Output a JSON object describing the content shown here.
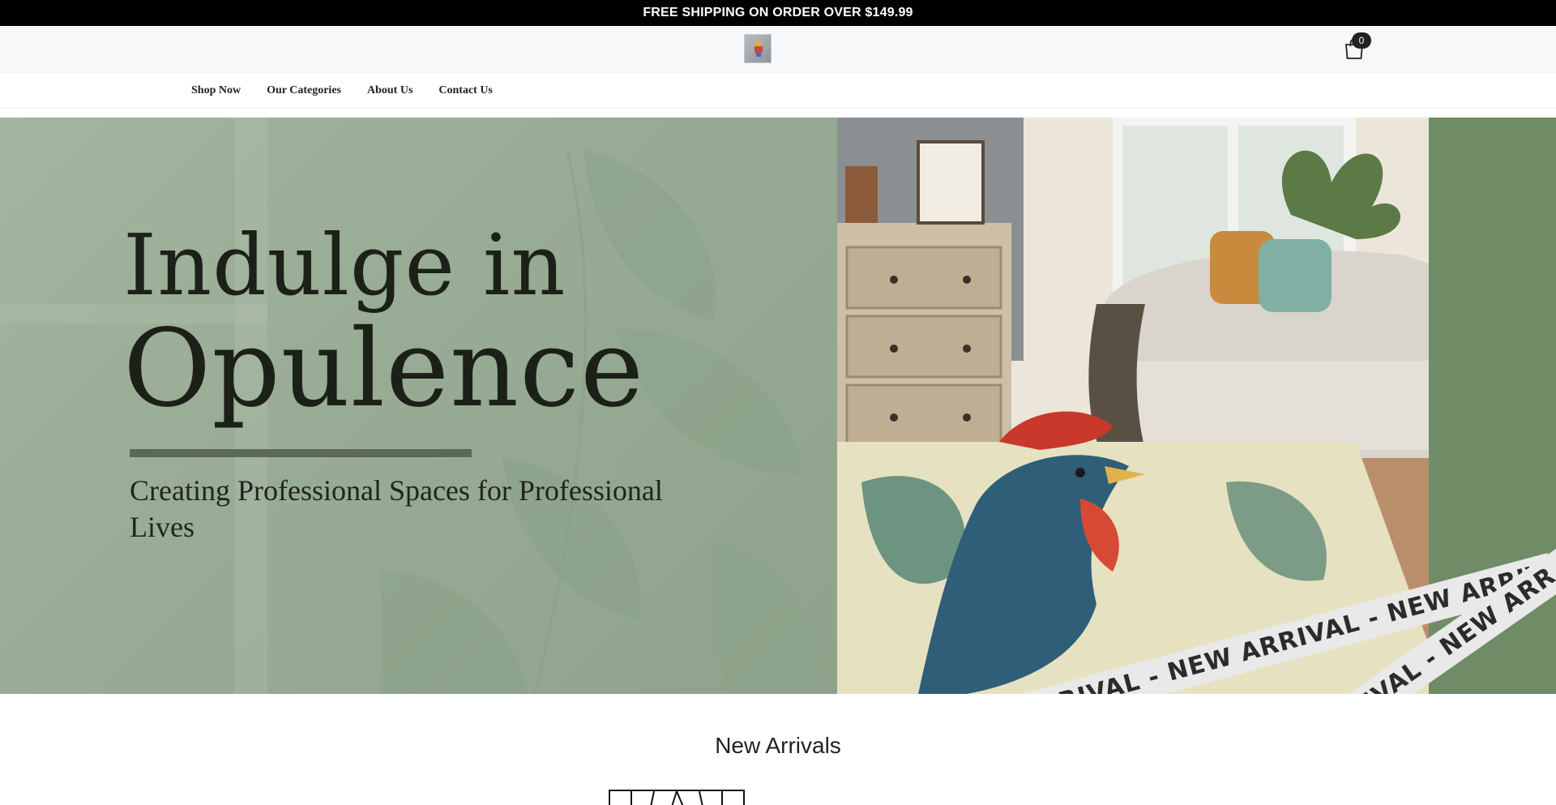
{
  "announcement": {
    "text": "FREE SHIPPING ON ORDER OVER $149.99"
  },
  "header": {
    "logo_icon": "store-logo",
    "cart_icon": "shopping-bag-icon",
    "cart_count": "0"
  },
  "nav": {
    "items": [
      {
        "label": "Shop Now"
      },
      {
        "label": "Our Categories"
      },
      {
        "label": "About Us"
      },
      {
        "label": "Contact Us"
      }
    ]
  },
  "hero": {
    "headline_line1": "Indulge in",
    "headline_line2": "Opulence",
    "subheadline": "Creating Professional Spaces for Professional Lives",
    "ribbon_text": "IVAL - NEW ARRIVAL - NEW ARRIVAL - NEW ARRIVAL - NEW ARR",
    "ribbon_text_2": "L - NEW ARRIVAL - NEW ARR",
    "colors": {
      "sage": "#9aae96",
      "band": "#6f8c66",
      "ink": "#1c2118"
    }
  },
  "new_arrivals": {
    "title": "New Arrivals"
  }
}
